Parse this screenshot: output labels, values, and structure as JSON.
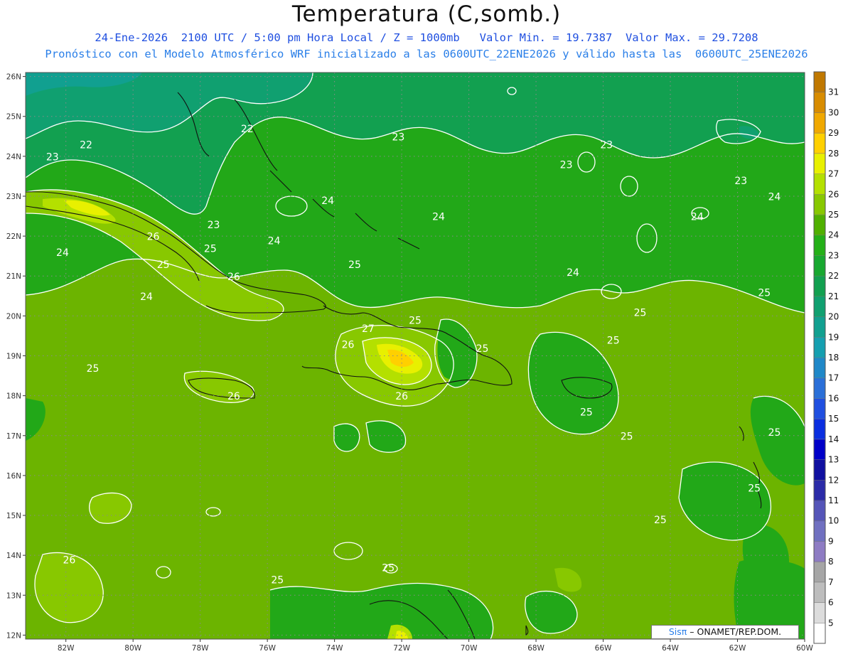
{
  "title": "Temperatura (C,somb.)",
  "subtitle_line1": "24-Ene-2026  2100 UTC / 5:00 pm Hora Local / Z = 1000mb   Valor Min. = 19.7387  Valor Max. = 29.7208",
  "subtitle_line2": "Pronóstico con el Modelo Atmosférico WRF inicializado a las 0600UTC_22ENE2026 y válido hasta las  0600UTC_25ENE2026",
  "map": {
    "lon_range": [
      -83.2,
      -60.0
    ],
    "lat_range": [
      11.9,
      26.1
    ],
    "lat_ticks": [
      "12N",
      "13N",
      "14N",
      "15N",
      "16N",
      "17N",
      "18N",
      "19N",
      "20N",
      "21N",
      "22N",
      "23N",
      "24N",
      "25N",
      "26N"
    ],
    "lat_values": [
      12,
      13,
      14,
      15,
      16,
      17,
      18,
      19,
      20,
      21,
      22,
      23,
      24,
      25,
      26
    ],
    "lon_ticks": [
      "82W",
      "80W",
      "78W",
      "76W",
      "74W",
      "72W",
      "70W",
      "68W",
      "66W",
      "64W",
      "62W",
      "60W"
    ],
    "lon_values": [
      -82,
      -80,
      -78,
      -76,
      -74,
      -72,
      -70,
      -68,
      -66,
      -64,
      -62,
      -60
    ],
    "grid": true,
    "contour_labels": [
      {
        "text": "22",
        "lon": -76.6,
        "lat": 24.6
      },
      {
        "text": "22",
        "lon": -81.4,
        "lat": 24.2
      },
      {
        "text": "23",
        "lon": -82.4,
        "lat": 23.9
      },
      {
        "text": "23",
        "lon": -72.1,
        "lat": 24.4
      },
      {
        "text": "23",
        "lon": -67.1,
        "lat": 23.7
      },
      {
        "text": "23",
        "lon": -65.9,
        "lat": 24.2
      },
      {
        "text": "23",
        "lon": -61.9,
        "lat": 23.3
      },
      {
        "text": "23",
        "lon": -77.6,
        "lat": 22.2
      },
      {
        "text": "24",
        "lon": -74.2,
        "lat": 22.8
      },
      {
        "text": "24",
        "lon": -70.9,
        "lat": 22.4
      },
      {
        "text": "24",
        "lon": -63.2,
        "lat": 22.4
      },
      {
        "text": "24",
        "lon": -60.9,
        "lat": 22.9
      },
      {
        "text": "24",
        "lon": -75.8,
        "lat": 21.8
      },
      {
        "text": "24",
        "lon": -82.1,
        "lat": 21.5
      },
      {
        "text": "24",
        "lon": -66.9,
        "lat": 21.0
      },
      {
        "text": "24",
        "lon": -79.6,
        "lat": 20.4
      },
      {
        "text": "25",
        "lon": -77.7,
        "lat": 21.6
      },
      {
        "text": "25",
        "lon": -79.1,
        "lat": 21.2
      },
      {
        "text": "25",
        "lon": -73.4,
        "lat": 21.2
      },
      {
        "text": "25",
        "lon": -71.6,
        "lat": 19.8
      },
      {
        "text": "25",
        "lon": -61.2,
        "lat": 20.5
      },
      {
        "text": "25",
        "lon": -64.9,
        "lat": 20.0
      },
      {
        "text": "25",
        "lon": -65.7,
        "lat": 19.3
      },
      {
        "text": "25",
        "lon": -69.6,
        "lat": 19.1
      },
      {
        "text": "25",
        "lon": -81.2,
        "lat": 18.6
      },
      {
        "text": "25",
        "lon": -66.5,
        "lat": 17.5
      },
      {
        "text": "25",
        "lon": -65.3,
        "lat": 16.9
      },
      {
        "text": "25",
        "lon": -60.9,
        "lat": 17.0
      },
      {
        "text": "25",
        "lon": -61.5,
        "lat": 15.6
      },
      {
        "text": "25",
        "lon": -64.3,
        "lat": 14.8
      },
      {
        "text": "25",
        "lon": -75.7,
        "lat": 13.3
      },
      {
        "text": "25",
        "lon": -72.4,
        "lat": 13.6
      },
      {
        "text": "26",
        "lon": -79.4,
        "lat": 21.9
      },
      {
        "text": "26",
        "lon": -77.0,
        "lat": 20.9
      },
      {
        "text": "26",
        "lon": -73.6,
        "lat": 19.2
      },
      {
        "text": "26",
        "lon": -72.0,
        "lat": 17.9
      },
      {
        "text": "26",
        "lon": -77.0,
        "lat": 17.9
      },
      {
        "text": "26",
        "lon": -81.9,
        "lat": 13.8
      },
      {
        "text": "27",
        "lon": -73.0,
        "lat": 19.6
      }
    ]
  },
  "colorbar": {
    "labels": [
      "5",
      "6",
      "7",
      "8",
      "9",
      "10",
      "11",
      "12",
      "13",
      "14",
      "15",
      "16",
      "17",
      "18",
      "19",
      "20",
      "21",
      "22",
      "23",
      "24",
      "25",
      "26",
      "27",
      "28",
      "29",
      "30",
      "31"
    ],
    "colors": [
      "#ffffff",
      "#dcdcdc",
      "#bdbdbd",
      "#a6a6a6",
      "#8e7cc3",
      "#7070c0",
      "#5555b8",
      "#2b2ba8",
      "#1010a0",
      "#0000c8",
      "#0a2ee0",
      "#1f4fe0",
      "#2a6fd8",
      "#1f88c8",
      "#159fb0",
      "#11a090",
      "#10a070",
      "#12a050",
      "#18a830",
      "#24b018",
      "#50b000",
      "#88c800",
      "#b4e000",
      "#e8f000",
      "#ffd000",
      "#f0a800",
      "#d88c00",
      "#c07800"
    ]
  },
  "credit": {
    "brand": "Sisπ",
    "text": "– ONAMET/REP.DOM."
  }
}
